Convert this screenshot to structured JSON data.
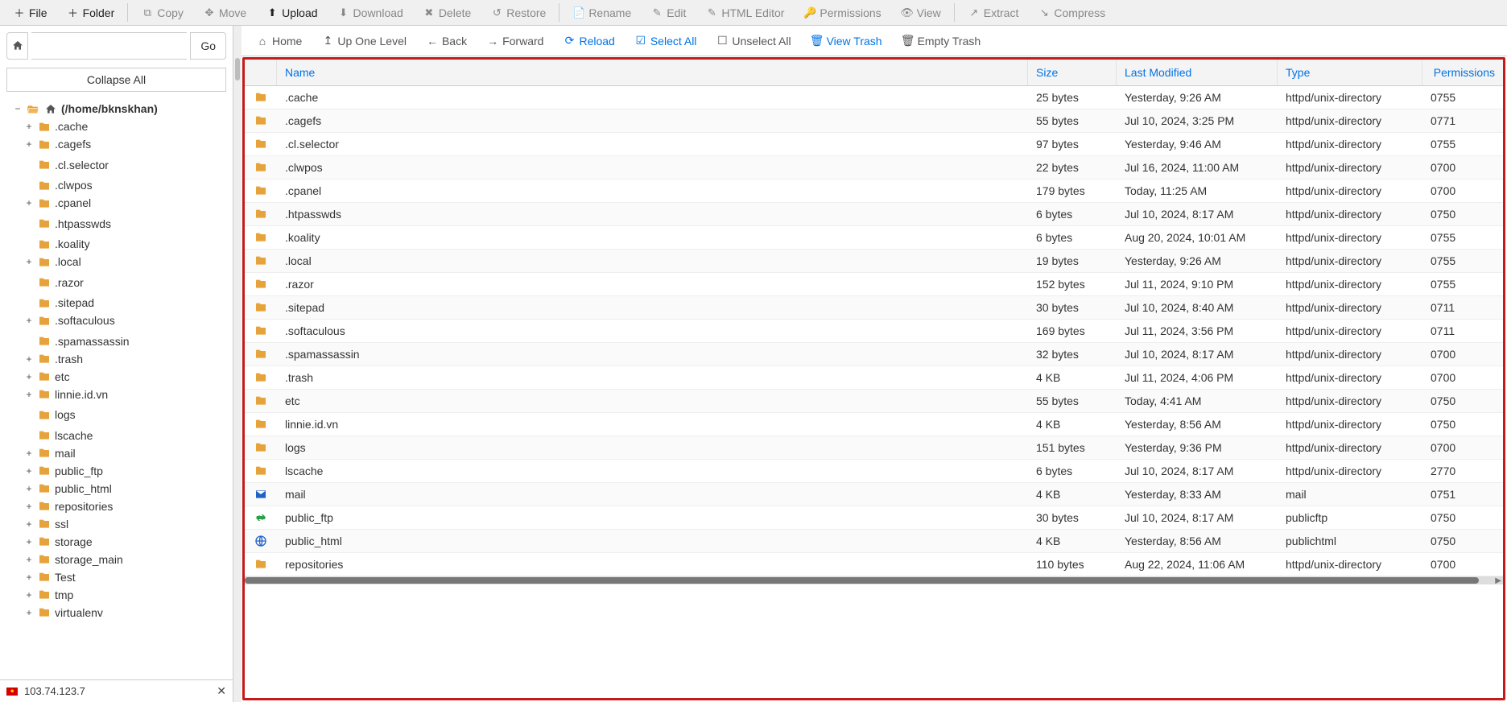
{
  "toolbar": {
    "file": "File",
    "folder": "Folder",
    "copy": "Copy",
    "move": "Move",
    "upload": "Upload",
    "download": "Download",
    "delete": "Delete",
    "restore": "Restore",
    "rename": "Rename",
    "edit": "Edit",
    "html_editor": "HTML Editor",
    "permissions": "Permissions",
    "view": "View",
    "extract": "Extract",
    "compress": "Compress"
  },
  "locbar": {
    "go": "Go",
    "value": ""
  },
  "collapse_all": "Collapse All",
  "secondbar": {
    "home": "Home",
    "up": "Up One Level",
    "back": "Back",
    "forward": "Forward",
    "reload": "Reload",
    "select_all": "Select All",
    "unselect_all": "Unselect All",
    "view_trash": "View Trash",
    "empty_trash": "Empty Trash"
  },
  "headers": {
    "name": "Name",
    "size": "Size",
    "modified": "Last Modified",
    "type": "Type",
    "permissions": "Permissions"
  },
  "status": {
    "ip": "103.74.123.7"
  },
  "tree": {
    "root_label": "(/home/bknskhan)",
    "items": [
      {
        "label": ".cache",
        "expandable": true
      },
      {
        "label": ".cagefs",
        "expandable": true
      },
      {
        "label": ".cl.selector",
        "expandable": false
      },
      {
        "label": ".clwpos",
        "expandable": false
      },
      {
        "label": ".cpanel",
        "expandable": true
      },
      {
        "label": ".htpasswds",
        "expandable": false
      },
      {
        "label": ".koality",
        "expandable": false
      },
      {
        "label": ".local",
        "expandable": true
      },
      {
        "label": ".razor",
        "expandable": false
      },
      {
        "label": ".sitepad",
        "expandable": false
      },
      {
        "label": ".softaculous",
        "expandable": true
      },
      {
        "label": ".spamassassin",
        "expandable": false
      },
      {
        "label": ".trash",
        "expandable": true
      },
      {
        "label": "etc",
        "expandable": true
      },
      {
        "label": "linnie.id.vn",
        "expandable": true
      },
      {
        "label": "logs",
        "expandable": false
      },
      {
        "label": "lscache",
        "expandable": false
      },
      {
        "label": "mail",
        "expandable": true
      },
      {
        "label": "public_ftp",
        "expandable": true
      },
      {
        "label": "public_html",
        "expandable": true
      },
      {
        "label": "repositories",
        "expandable": true
      },
      {
        "label": "ssl",
        "expandable": true
      },
      {
        "label": "storage",
        "expandable": true
      },
      {
        "label": "storage_main",
        "expandable": true
      },
      {
        "label": "Test",
        "expandable": true
      },
      {
        "label": "tmp",
        "expandable": true
      },
      {
        "label": "virtualenv",
        "expandable": true
      }
    ]
  },
  "files": [
    {
      "icon": "folder",
      "name": ".cache",
      "size": "25 bytes",
      "modified": "Yesterday, 9:26 AM",
      "type": "httpd/unix-directory",
      "perm": "0755"
    },
    {
      "icon": "folder",
      "name": ".cagefs",
      "size": "55 bytes",
      "modified": "Jul 10, 2024, 3:25 PM",
      "type": "httpd/unix-directory",
      "perm": "0771"
    },
    {
      "icon": "folder",
      "name": ".cl.selector",
      "size": "97 bytes",
      "modified": "Yesterday, 9:46 AM",
      "type": "httpd/unix-directory",
      "perm": "0755"
    },
    {
      "icon": "folder",
      "name": ".clwpos",
      "size": "22 bytes",
      "modified": "Jul 16, 2024, 11:00 AM",
      "type": "httpd/unix-directory",
      "perm": "0700"
    },
    {
      "icon": "folder",
      "name": ".cpanel",
      "size": "179 bytes",
      "modified": "Today, 11:25 AM",
      "type": "httpd/unix-directory",
      "perm": "0700"
    },
    {
      "icon": "folder",
      "name": ".htpasswds",
      "size": "6 bytes",
      "modified": "Jul 10, 2024, 8:17 AM",
      "type": "httpd/unix-directory",
      "perm": "0750"
    },
    {
      "icon": "folder",
      "name": ".koality",
      "size": "6 bytes",
      "modified": "Aug 20, 2024, 10:01 AM",
      "type": "httpd/unix-directory",
      "perm": "0755"
    },
    {
      "icon": "folder",
      "name": ".local",
      "size": "19 bytes",
      "modified": "Yesterday, 9:26 AM",
      "type": "httpd/unix-directory",
      "perm": "0755"
    },
    {
      "icon": "folder",
      "name": ".razor",
      "size": "152 bytes",
      "modified": "Jul 11, 2024, 9:10 PM",
      "type": "httpd/unix-directory",
      "perm": "0755"
    },
    {
      "icon": "folder",
      "name": ".sitepad",
      "size": "30 bytes",
      "modified": "Jul 10, 2024, 8:40 AM",
      "type": "httpd/unix-directory",
      "perm": "0711"
    },
    {
      "icon": "folder",
      "name": ".softaculous",
      "size": "169 bytes",
      "modified": "Jul 11, 2024, 3:56 PM",
      "type": "httpd/unix-directory",
      "perm": "0711"
    },
    {
      "icon": "folder",
      "name": ".spamassassin",
      "size": "32 bytes",
      "modified": "Jul 10, 2024, 8:17 AM",
      "type": "httpd/unix-directory",
      "perm": "0700"
    },
    {
      "icon": "folder",
      "name": ".trash",
      "size": "4 KB",
      "modified": "Jul 11, 2024, 4:06 PM",
      "type": "httpd/unix-directory",
      "perm": "0700"
    },
    {
      "icon": "folder",
      "name": "etc",
      "size": "55 bytes",
      "modified": "Today, 4:41 AM",
      "type": "httpd/unix-directory",
      "perm": "0750"
    },
    {
      "icon": "folder",
      "name": "linnie.id.vn",
      "size": "4 KB",
      "modified": "Yesterday, 8:56 AM",
      "type": "httpd/unix-directory",
      "perm": "0750"
    },
    {
      "icon": "folder",
      "name": "logs",
      "size": "151 bytes",
      "modified": "Yesterday, 9:36 PM",
      "type": "httpd/unix-directory",
      "perm": "0700"
    },
    {
      "icon": "folder",
      "name": "lscache",
      "size": "6 bytes",
      "modified": "Jul 10, 2024, 8:17 AM",
      "type": "httpd/unix-directory",
      "perm": "2770"
    },
    {
      "icon": "mail",
      "name": "mail",
      "size": "4 KB",
      "modified": "Yesterday, 8:33 AM",
      "type": "mail",
      "perm": "0751"
    },
    {
      "icon": "ftp",
      "name": "public_ftp",
      "size": "30 bytes",
      "modified": "Jul 10, 2024, 8:17 AM",
      "type": "publicftp",
      "perm": "0750"
    },
    {
      "icon": "web",
      "name": "public_html",
      "size": "4 KB",
      "modified": "Yesterday, 8:56 AM",
      "type": "publichtml",
      "perm": "0750"
    },
    {
      "icon": "folder",
      "name": "repositories",
      "size": "110 bytes",
      "modified": "Aug 22, 2024, 11:06 AM",
      "type": "httpd/unix-directory",
      "perm": "0700"
    }
  ]
}
